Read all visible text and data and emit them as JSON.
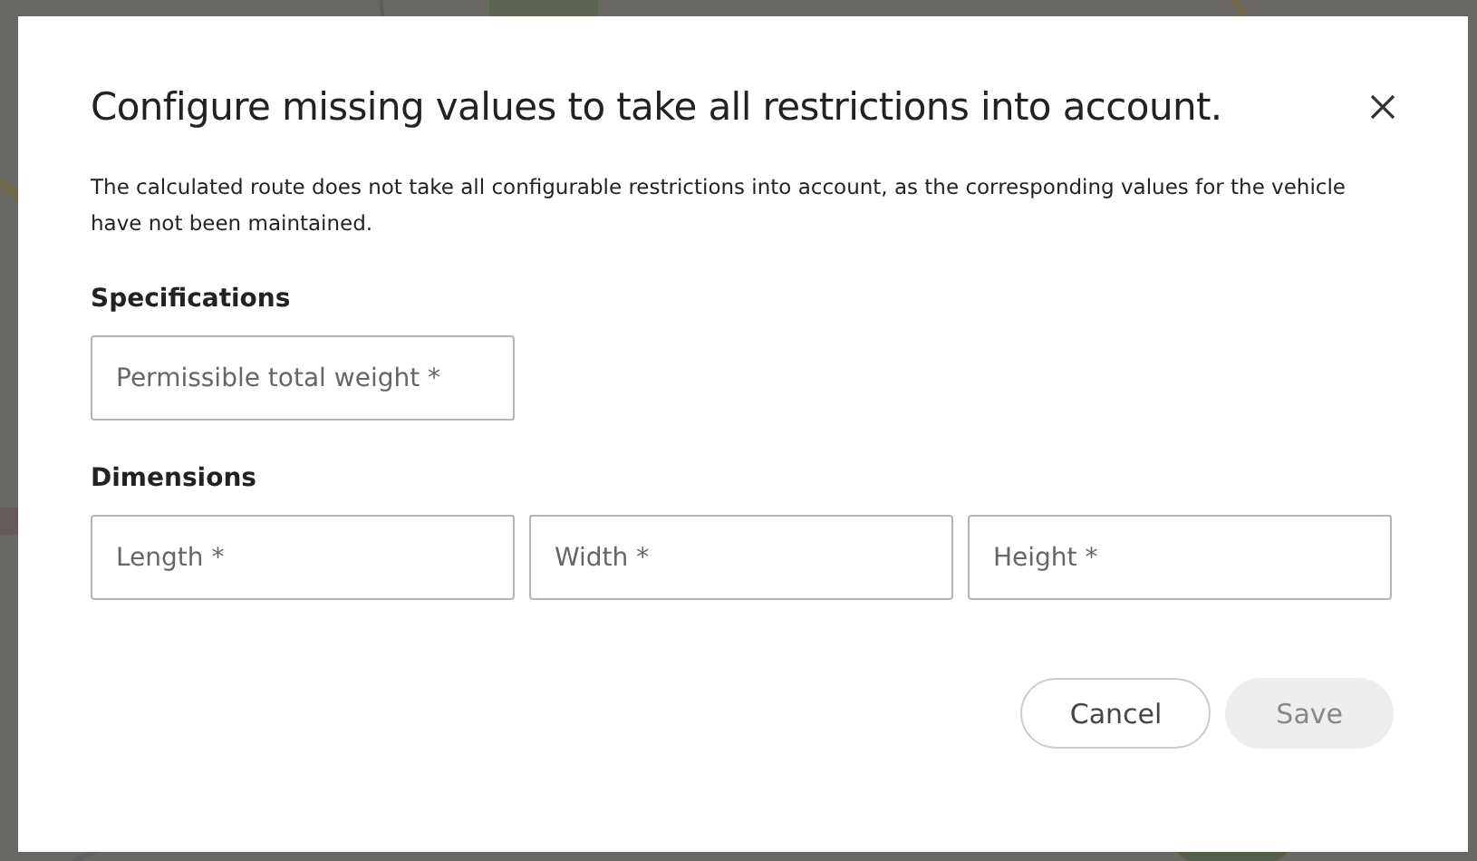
{
  "dialog": {
    "title": "Configure missing values to take all restrictions into account.",
    "description": "The calculated route does not take all configurable restrictions into account, as the corresponding values for the vehicle have not been maintained.",
    "sections": [
      {
        "heading": "Specifications",
        "fields": [
          {
            "placeholder": "Permissible total weight *"
          }
        ]
      },
      {
        "heading": "Dimensions",
        "fields": [
          {
            "placeholder": "Length *"
          },
          {
            "placeholder": "Width *"
          },
          {
            "placeholder": "Height *"
          }
        ]
      }
    ],
    "buttons": [
      {
        "label": "Cancel",
        "disabled": false
      },
      {
        "label": "Save",
        "disabled": true
      }
    ]
  }
}
